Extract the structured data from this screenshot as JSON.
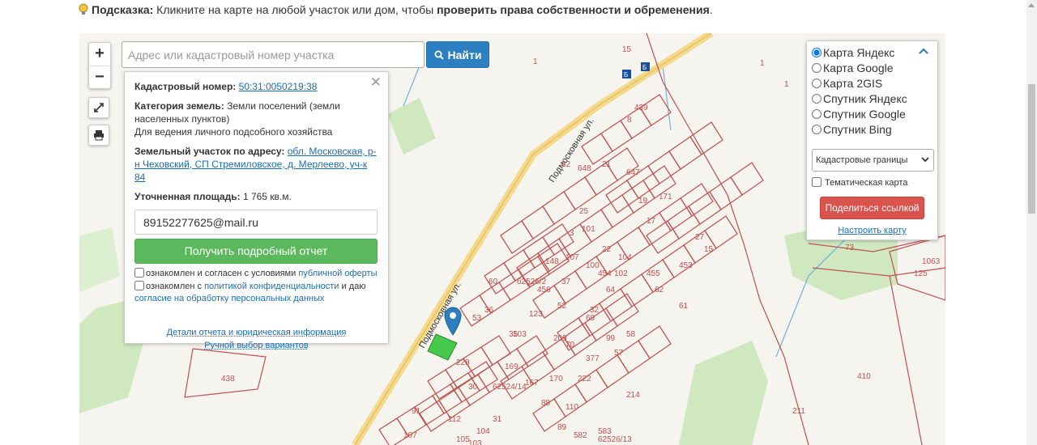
{
  "hint": {
    "label": "Подсказка:",
    "text_before": " Кликните на карте на любой участок или дом, чтобы ",
    "text_bold": "проверить права собственности и обременения",
    "text_after": "."
  },
  "map": {
    "zoom_in": "+",
    "zoom_out": "−",
    "street_labels": [
      "Подмосковная ул.",
      "Подмосковная ул."
    ],
    "parcel_labels": [
      "15",
      "1",
      "1",
      "1",
      "439",
      "8",
      "21",
      "32",
      "648",
      "647",
      "19",
      "25",
      "3",
      "17",
      "101",
      "27",
      "15",
      "22",
      "104",
      "107",
      "148",
      "100",
      "102",
      "455",
      "454",
      "453",
      "37",
      "456",
      "64",
      "62",
      "52",
      "32",
      "61",
      "60",
      "53",
      "36",
      "123",
      "209",
      "69",
      "70",
      "99",
      "35",
      "377",
      "58",
      "57",
      "103",
      "169",
      "167",
      "170",
      "110",
      "222",
      "88",
      "89",
      "103",
      "112",
      "91",
      "30",
      "31",
      "105",
      "104",
      "107",
      "582",
      "583",
      "1063",
      "125",
      "73",
      "438",
      "214",
      "410",
      "228",
      "62526/13",
      "62524/14",
      "62526/2",
      "211",
      "171",
      "1"
    ],
    "icons": [
      "bus-stop-icon",
      "bus-stop-icon"
    ]
  },
  "search": {
    "placeholder": "Адрес или кадастровый номер участка",
    "button": "Найти"
  },
  "info": {
    "cad_label": "Кадастровый номер:",
    "cad_value": "50:31:0050219:38",
    "category_label": "Категория земель:",
    "category_value": "Земли поселений (земли населенных пунктов)",
    "usage": "Для ведения личного подсобного хозяйства",
    "address_label": "Земельный участок по адресу:",
    "address_value": "обл. Московская, р-н Чеховский, СП Стремиловское, д. Мерлеево, уч-к 84",
    "area_label": "Уточненная площадь:",
    "area_value": "1 765 кв.м.",
    "email_value": "89152277625@mail.ru",
    "report_button": "Получить подробный отчет",
    "agree1_before": "ознакомлен и согласен с условиями ",
    "agree1_link": "публичной оферты",
    "agree2_before": "ознакомлен с ",
    "agree2_link": "политикой конфиденциальности",
    "agree2_mid": " и даю ",
    "agree2_link2": "согласие на обработку персональных данных",
    "details_link": "Детали отчета и юридическая информация",
    "manual_link": "Ручной выбор вариантов"
  },
  "layers": {
    "options": [
      {
        "label": "Карта Яндекс",
        "checked": true
      },
      {
        "label": "Карта Google",
        "checked": false
      },
      {
        "label": "Карта 2GIS",
        "checked": false
      },
      {
        "label": "Спутник Яндекс",
        "checked": false
      },
      {
        "label": "Спутник Google",
        "checked": false
      },
      {
        "label": "Спутник Bing",
        "checked": false
      }
    ],
    "select_value": "Кадастровые границы",
    "thematic": "Тематическая карта",
    "share_button": "Поделиться ссылкой",
    "config_link": "Настроить карту"
  },
  "colors": {
    "parcel_border": "#c0504d",
    "road": "#f4d98a",
    "green": "#cfe8c0",
    "water": "#6fb0e0",
    "selected_parcel": "#46c84a"
  }
}
